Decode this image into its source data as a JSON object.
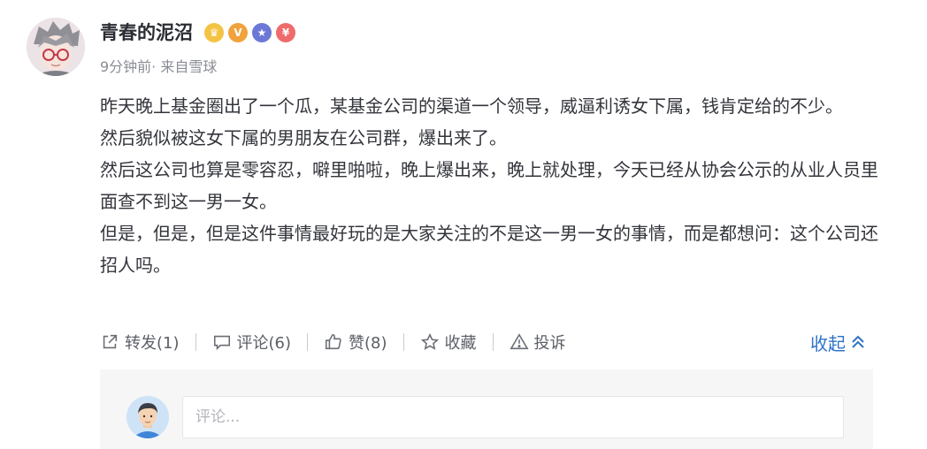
{
  "post": {
    "username": "青春的泥沼",
    "meta": "9分钟前· 来自雪球",
    "badges": [
      {
        "name": "crown-badge-icon",
        "color": "#f3c344",
        "glyph": "♛"
      },
      {
        "name": "v-badge-icon",
        "color": "#f0a23c",
        "glyph": "V"
      },
      {
        "name": "star-badge-icon",
        "color": "#6b78d6",
        "glyph": "★"
      },
      {
        "name": "yen-badge-icon",
        "color": "#ef6a6a",
        "glyph": "¥"
      }
    ],
    "paragraphs": [
      "昨天晚上基金圈出了一个瓜，某基金公司的渠道一个领导，威逼利诱女下属，钱肯定给的不少。",
      "然后貌似被这女下属的男朋友在公司群，爆出来了。",
      "然后这公司也算是零容忍，噼里啪啦，晚上爆出来，晚上就处理，今天已经从协会公示的从业人员里面查不到这一男一女。",
      "但是，但是，但是这件事情最好玩的是大家关注的不是这一男一女的事情，而是都想问：这个公司还招人吗。"
    ]
  },
  "actions": {
    "repost": "转发(1)",
    "comment": "评论(6)",
    "like": "赞(8)",
    "favorite": "收藏",
    "report": "投诉",
    "collapse": "收起"
  },
  "comment_box": {
    "placeholder": "评论..."
  },
  "colors": {
    "accent": "#2f73c7",
    "text": "#33353c",
    "muted": "#8a8d94"
  }
}
